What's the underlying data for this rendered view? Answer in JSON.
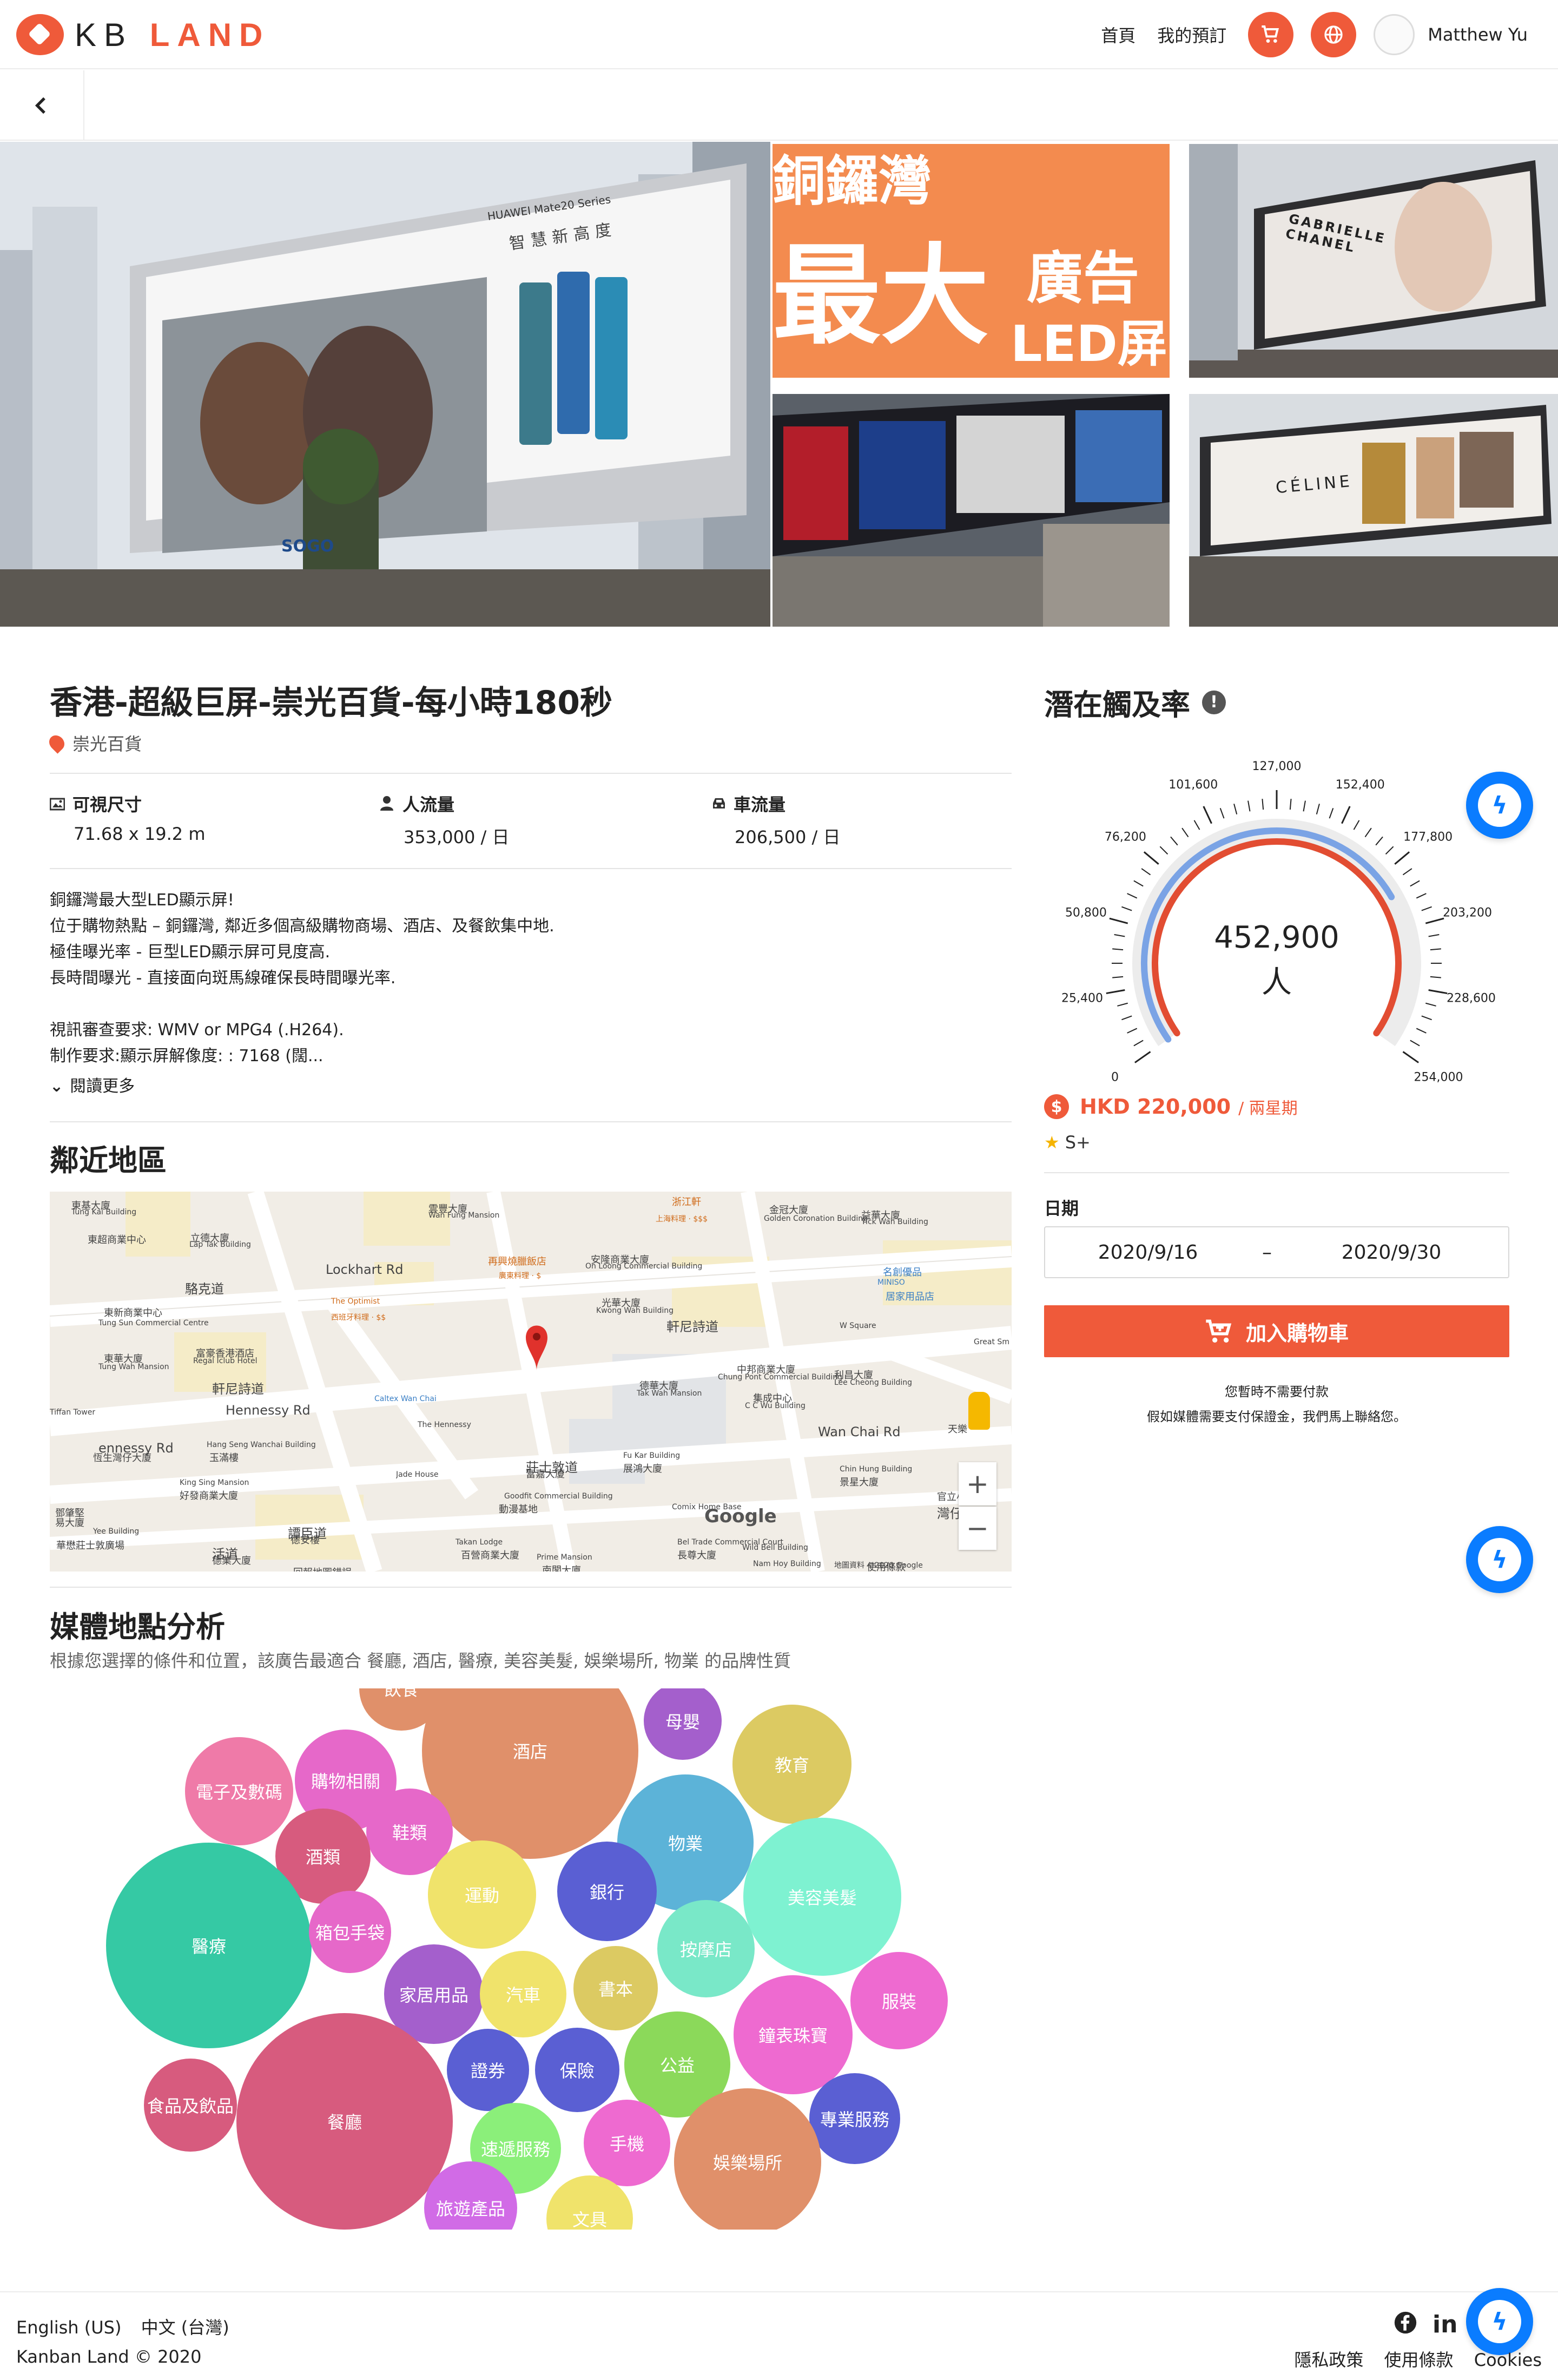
{
  "header": {
    "logo_kb": "KB",
    "logo_land": "LAND",
    "nav_home": "首頁",
    "nav_orders": "我的預訂",
    "user_name": "Matthew Yu"
  },
  "photos": {
    "promo_line1": "銅鑼灣",
    "promo_big": "最大",
    "promo_ad": "廣告",
    "promo_led": "LED屏",
    "brand_chanel": "GABRIELLE CHANEL",
    "brand_celine": "CÉLINE",
    "brand_huawei": "HUAWEI Mate20 Series",
    "brand_huawei_slogan": "智慧新高度",
    "brand_sogo": "SOGO"
  },
  "listing": {
    "title": "香港-超級巨屏-崇光百貨-每小時180秒",
    "location": "崇光百貨",
    "stats": [
      {
        "label": "可視尺寸",
        "value": "71.68 x 19.2 m",
        "icon": "image-icon"
      },
      {
        "label": "人流量",
        "value": "353,000 / 日",
        "icon": "person-icon"
      },
      {
        "label": "車流量",
        "value": "206,500 / 日",
        "icon": "car-icon"
      }
    ],
    "description": "銅鑼灣最大型LED顯示屏!\n位于購物熱點 – 銅鑼灣, 鄰近多個高級購物商場、酒店、及餐飲集中地.\n極佳曝光率 - 巨型LED顯示屏可見度高.\n長時間曝光 - 直接面向斑馬線確保長時間曝光率.\n\n視訊審查要求: WMV or MPG4 (.H264).\n制作要求:顯示屏解像度: : 7168 (闊...",
    "read_more": "閱讀更多"
  },
  "nearby": {
    "heading": "鄰近地區",
    "labels": [
      "東基大廈",
      "Tung Kai Building",
      "東超商業中心",
      "立德大廈",
      "Lap Tak Building",
      "雲豐大廈",
      "Wan Fung Mansion",
      "浙江軒",
      "上海料理 · $$$",
      "金冠大廈",
      "Golden Coronation Building",
      "益華大廈",
      "Yick Wah Building",
      "Lockhart Rd",
      "再興燒臘飯店",
      "廣東料理 · $",
      "安隆商業大廈",
      "On Loong Commercial Building",
      "名創優品",
      "MINISO",
      "居家用品店",
      "駱克道",
      "東新商業中心",
      "Tung Sun Commercial Centre",
      "The Optimist",
      "西班牙料理 · $$",
      "光華大廈",
      "Kwong Wah Building",
      "軒尼詩道",
      "W Square",
      "Great Sm",
      "東華大廈",
      "Tung Wah Mansion",
      "富豪香港酒店",
      "Regal Iclub Hotel",
      "中邦商業大廈",
      "Chung Pont Commercial Building",
      "利昌大廈",
      "Lee Cheong Building",
      "軒尼詩道",
      "Hennessy Rd",
      "Caltex Wan Chai",
      "德華大廈",
      "Tak Wah Mansion",
      "集成中心",
      "C C Wu Building",
      "The Hennessy",
      "Wan Chai Rd",
      "天樂",
      "Tiffan Tower",
      "ennessy Rd",
      "恆生灣仔大廈",
      "Hang Seng Wanchai Building",
      "玉滿樓",
      "Jade House",
      "莊士敦道",
      "富嘉大廈",
      "Fu Kar Building",
      "展鴻大廈",
      "Chin Hung Building",
      "景星大廈",
      "King Sing Mansion",
      "好發商業大廈",
      "Goodfit Commercial Building",
      "動漫基地",
      "Comix Home Base",
      "灣仔道",
      "官立小",
      "鄧肇堅",
      "易大廈",
      "Yee Building",
      "譚臣道",
      "德安樓",
      "Takan Lodge",
      "百營商業大廈",
      "Bel Trade Commercial Court",
      "長尊大廈",
      "Wild Bell Building",
      "活道",
      "德業大廈",
      "Prime Mansion",
      "南閣大廈",
      "Nam Hoy Building",
      "地圖資料 ©2020 Google",
      "使用條款",
      "回報地圖錯誤",
      "華懋莊士敦廣場",
      "Google"
    ]
  },
  "analysis": {
    "heading": "媒體地點分析",
    "subtitle": "根據您選擇的條件和位置，該廣告最適合 餐廳, 酒店, 醫療, 美容美髮, 娛樂場所, 物業 的品牌性質",
    "bubbles": [
      {
        "label": "飲食",
        "color": "#e0906a"
      },
      {
        "label": "酒店",
        "color": "#e0906a"
      },
      {
        "label": "母嬰",
        "color": "#a45fcc"
      },
      {
        "label": "教育",
        "color": "#dcca62"
      },
      {
        "label": "購物相關",
        "color": "#e668c9"
      },
      {
        "label": "電子及數碼",
        "color": "#ef7aa8"
      },
      {
        "label": "鞋類",
        "color": "#e668c9"
      },
      {
        "label": "物業",
        "color": "#5cb3d8"
      },
      {
        "label": "美容美髮",
        "color": "#7ef2d1"
      },
      {
        "label": "酒類",
        "color": "#d75b7e"
      },
      {
        "label": "運動",
        "color": "#f0e36b"
      },
      {
        "label": "銀行",
        "color": "#5a5fd3"
      },
      {
        "label": "醫療",
        "color": "#35c9a4"
      },
      {
        "label": "箱包手袋",
        "color": "#e668c9"
      },
      {
        "label": "按摩店",
        "color": "#79e8c8"
      },
      {
        "label": "家居用品",
        "color": "#a45fcc"
      },
      {
        "label": "汽車",
        "color": "#f0e36b"
      },
      {
        "label": "書本",
        "color": "#dcca62"
      },
      {
        "label": "服裝",
        "color": "#ee6ad0"
      },
      {
        "label": "鐘表珠寶",
        "color": "#ee6ad0"
      },
      {
        "label": "證券",
        "color": "#5a5fd3"
      },
      {
        "label": "保險",
        "color": "#5a5fd3"
      },
      {
        "label": "公益",
        "color": "#8bd95a"
      },
      {
        "label": "食品及飲品",
        "color": "#d75b7e"
      },
      {
        "label": "餐廳",
        "color": "#d75b7e"
      },
      {
        "label": "專業服務",
        "color": "#5a5fd3"
      },
      {
        "label": "手機",
        "color": "#ee6ad0"
      },
      {
        "label": "速遞服務",
        "color": "#8bef7a"
      },
      {
        "label": "娛樂場所",
        "color": "#e0906a"
      },
      {
        "label": "旅遊產品",
        "color": "#d16be6"
      },
      {
        "label": "文具",
        "color": "#f0e36b"
      }
    ]
  },
  "reach": {
    "heading": "潛在觸及率",
    "info_icon": "info-icon",
    "value": "452,900",
    "unit": "人",
    "ticks": [
      "0",
      "25,400",
      "50,800",
      "76,200",
      "101,600",
      "127,000",
      "152,400",
      "177,800",
      "203,200",
      "228,600",
      "254,000"
    ],
    "outer_level": 0.74,
    "inner_level": 1.0,
    "outer_color": "#7aa3e5",
    "inner_color": "#e24d32"
  },
  "booking": {
    "price": "HKD 220,000",
    "period": "/ 兩星期",
    "rating": "S+",
    "date_label": "日期",
    "date_from": "2020/9/16",
    "date_sep": "–",
    "date_to": "2020/9/30",
    "cart_label": "加入購物車",
    "note1": "您暫時不需要付款",
    "note2": "假如媒體需要支付保證金，我們馬上聯絡您。"
  },
  "footer": {
    "lang_en": "English (US)",
    "lang_zh": "中文 (台灣)",
    "copyright": "Kanban Land © 2020",
    "privacy": "隱私政策",
    "terms": "使用條款",
    "cookies": "Cookies"
  },
  "colors": {
    "accent": "#ef5a3a",
    "messenger": "#0a7cff"
  }
}
